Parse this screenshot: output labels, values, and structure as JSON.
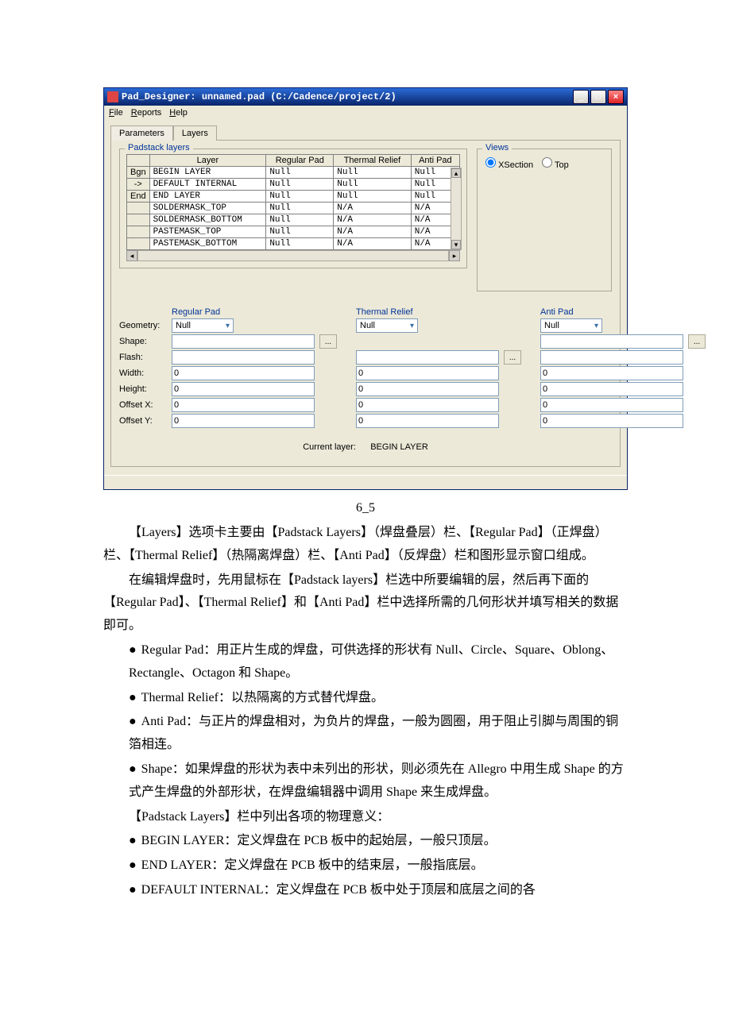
{
  "window": {
    "title": "Pad_Designer: unnamed.pad (C:/Cadence/project/2)",
    "menu": {
      "file": "File",
      "reports": "Reports",
      "help": "Help"
    },
    "tabs": {
      "parameters": "Parameters",
      "layers": "Layers"
    }
  },
  "padstack": {
    "legend": "Padstack layers",
    "headers": {
      "layer": "Layer",
      "regular": "Regular Pad",
      "thermal": "Thermal Relief",
      "anti": "Anti Pad"
    },
    "rows": [
      {
        "hdr": "Bgn",
        "layer": "BEGIN LAYER",
        "reg": "Null",
        "th": "Null",
        "anti": "Null"
      },
      {
        "hdr": "->",
        "layer": "DEFAULT INTERNAL",
        "reg": "Null",
        "th": "Null",
        "anti": "Null"
      },
      {
        "hdr": "End",
        "layer": "END LAYER",
        "reg": "Null",
        "th": "Null",
        "anti": "Null"
      },
      {
        "hdr": "",
        "layer": "SOLDERMASK_TOP",
        "reg": "Null",
        "th": "N/A",
        "anti": "N/A"
      },
      {
        "hdr": "",
        "layer": "SOLDERMASK_BOTTOM",
        "reg": "Null",
        "th": "N/A",
        "anti": "N/A"
      },
      {
        "hdr": "",
        "layer": "PASTEMASK_TOP",
        "reg": "Null",
        "th": "N/A",
        "anti": "N/A"
      },
      {
        "hdr": "",
        "layer": "PASTEMASK_BOTTOM",
        "reg": "Null",
        "th": "N/A",
        "anti": "N/A"
      }
    ]
  },
  "views": {
    "legend": "Views",
    "xsection": "XSection",
    "top": "Top"
  },
  "padcols": {
    "regular": "Regular Pad",
    "thermal": "Thermal Relief",
    "anti": "Anti Pad"
  },
  "labels": {
    "geometry": "Geometry:",
    "shape": "Shape:",
    "flash": "Flash:",
    "width": "Width:",
    "height": "Height:",
    "offsetx": "Offset X:",
    "offsety": "Offset Y:",
    "sel_null": "Null",
    "zero": "0",
    "ellipsis": "...",
    "current_label": "Current layer:",
    "current_value": "BEGIN LAYER"
  },
  "doc": {
    "caption": "6_5",
    "p1": "【Layers】选项卡主要由【Padstack Layers】（焊盘叠层）栏、【Regular Pad】（正焊盘）栏、【Thermal Relief】（热隔离焊盘）栏、【Anti Pad】（反焊盘）栏和图形显示窗口组成。",
    "p2": "在编辑焊盘时，先用鼠标在【Padstack layers】栏选中所要编辑的层，然后再下面的【Regular Pad】、【Thermal Relief】和【Anti Pad】栏中选择所需的几何形状并填写相关的数据即可。",
    "b1": "Regular Pad：用正片生成的焊盘，可供选择的形状有 Null、Circle、Square、Oblong、Rectangle、Octagon 和 Shape。",
    "b2": "Thermal Relief：以热隔离的方式替代焊盘。",
    "b3": "Anti Pad：与正片的焊盘相对，为负片的焊盘，一般为圆圈，用于阻止引脚与周围的铜箔相连。",
    "b4": "Shape：如果焊盘的形状为表中未列出的形状，则必须先在 Allegro 中用生成 Shape 的方式产生焊盘的外部形状，在焊盘编辑器中调用 Shape 来生成焊盘。",
    "p3": "【Padstack Layers】栏中列出各项的物理意义：",
    "c1": "BEGIN LAYER：定义焊盘在 PCB 板中的起始层，一般只顶层。",
    "c2": "END LAYER：定义焊盘在 PCB 板中的结束层，一般指底层。",
    "c3": "DEFAULT INTERNAL：定义焊盘在 PCB 板中处于顶层和底层之间的各"
  }
}
